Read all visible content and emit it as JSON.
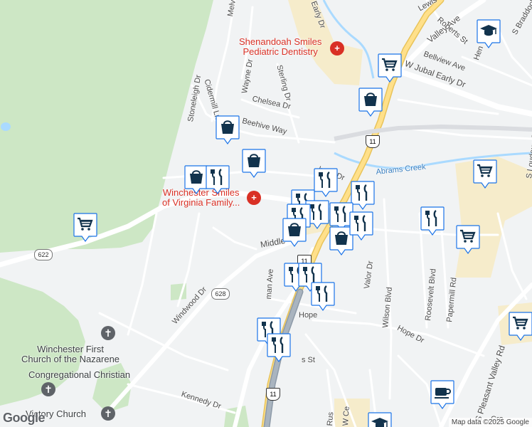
{
  "streets": [
    {
      "id": "melvor",
      "text": "Melvor Ln"
    },
    {
      "id": "wayne",
      "text": "Wayne Dr"
    },
    {
      "id": "cidermill",
      "text": "Cidermill Ln"
    },
    {
      "id": "stoneleigh",
      "text": "Stoneleigh Dr"
    },
    {
      "id": "sterling",
      "text": "Sterling Dr"
    },
    {
      "id": "chelsea",
      "text": "Chelsea Dr"
    },
    {
      "id": "beehive",
      "text": "Beehive Way"
    },
    {
      "id": "middle",
      "text": "Middle"
    },
    {
      "id": "windwood",
      "text": "Windwood Dr"
    },
    {
      "id": "kennedy",
      "text": "Kennedy Dr"
    },
    {
      "id": "hope",
      "text": "Hope"
    },
    {
      "id": "hope2",
      "text": "Hope Dr"
    },
    {
      "id": "valor",
      "text": "Valor Dr"
    },
    {
      "id": "wilson",
      "text": "Wilson Blvd"
    },
    {
      "id": "roosevelt",
      "text": "Roosevelt Blvd"
    },
    {
      "id": "papermill",
      "text": "Papermill Rd"
    },
    {
      "id": "pleasant",
      "text": "S Pleasant Valley Rd"
    },
    {
      "id": "abrams",
      "text": "Abrams Creek"
    },
    {
      "id": "jubal",
      "text": "W Jubal Early Dr"
    },
    {
      "id": "valleyave",
      "text": "Valley Ave"
    },
    {
      "id": "bellview",
      "text": "Bellview Ave"
    },
    {
      "id": "roberts",
      "text": "Roberts St"
    },
    {
      "id": "braddock",
      "text": "S Braddock"
    },
    {
      "id": "lewis",
      "text": "Lewis"
    },
    {
      "id": "early",
      "text": "Early Dr"
    },
    {
      "id": "loudoun",
      "text": "S Loudoun St"
    },
    {
      "id": "manave",
      "text": "man Ave"
    },
    {
      "id": "lmandr",
      "text": "lman Dr"
    },
    {
      "id": "sst",
      "text": "s St"
    },
    {
      "id": "rus",
      "text": "Rus"
    },
    {
      "id": "wce",
      "text": "W Ce"
    },
    {
      "id": "cro",
      "text": "Cro"
    },
    {
      "id": "hen",
      "text": "Hen"
    }
  ],
  "shields": [
    {
      "id": "r622",
      "text": "622"
    },
    {
      "id": "r628",
      "text": "628"
    },
    {
      "id": "us11a",
      "text": "11"
    },
    {
      "id": "us11b",
      "text": "11"
    },
    {
      "id": "us11c",
      "text": "11"
    }
  ],
  "pois": [
    {
      "id": "shenandoah",
      "text": "Shenandoah Smiles\nPediatric Dentistry",
      "icon": "medical-icon"
    },
    {
      "id": "winchester_smiles",
      "text": "Winchester Smiles\nof Virginia Family...",
      "icon": "medical-icon"
    },
    {
      "id": "nazarene",
      "text": "Winchester First\nChurch of the Nazarene",
      "icon": "cross-icon"
    },
    {
      "id": "congregational",
      "text": "Congregational Christian",
      "icon": "cross-icon"
    },
    {
      "id": "victory",
      "text": "Victory Church",
      "icon": "cross-icon"
    }
  ],
  "markers": [
    {
      "type": "school"
    },
    {
      "type": "cart"
    },
    {
      "type": "bag"
    },
    {
      "type": "bag"
    },
    {
      "type": "bag"
    },
    {
      "type": "bag"
    },
    {
      "type": "restaurant"
    },
    {
      "type": "restaurant"
    },
    {
      "type": "restaurant"
    },
    {
      "type": "cart"
    },
    {
      "type": "restaurant"
    },
    {
      "type": "restaurant"
    },
    {
      "type": "restaurant"
    },
    {
      "type": "restaurant"
    },
    {
      "type": "bag"
    },
    {
      "type": "bag"
    },
    {
      "type": "restaurant"
    },
    {
      "type": "cart"
    },
    {
      "type": "cart"
    },
    {
      "type": "restaurant"
    },
    {
      "type": "restaurant"
    },
    {
      "type": "restaurant"
    },
    {
      "type": "restaurant"
    },
    {
      "type": "restaurant"
    },
    {
      "type": "restaurant"
    },
    {
      "type": "cart"
    },
    {
      "type": "coffee"
    },
    {
      "type": "school"
    }
  ],
  "attribution": "Map data ©2025 Google",
  "logo": "Google",
  "colors": {
    "marker_fill": "#ffffff",
    "marker_border": "#1a73e8",
    "icon": "#12334d",
    "poi_red": "#d93025",
    "park": "#cde7c5",
    "commercial": "#f6eccb",
    "water": "#aadaff",
    "highway": "#ffe08a"
  }
}
